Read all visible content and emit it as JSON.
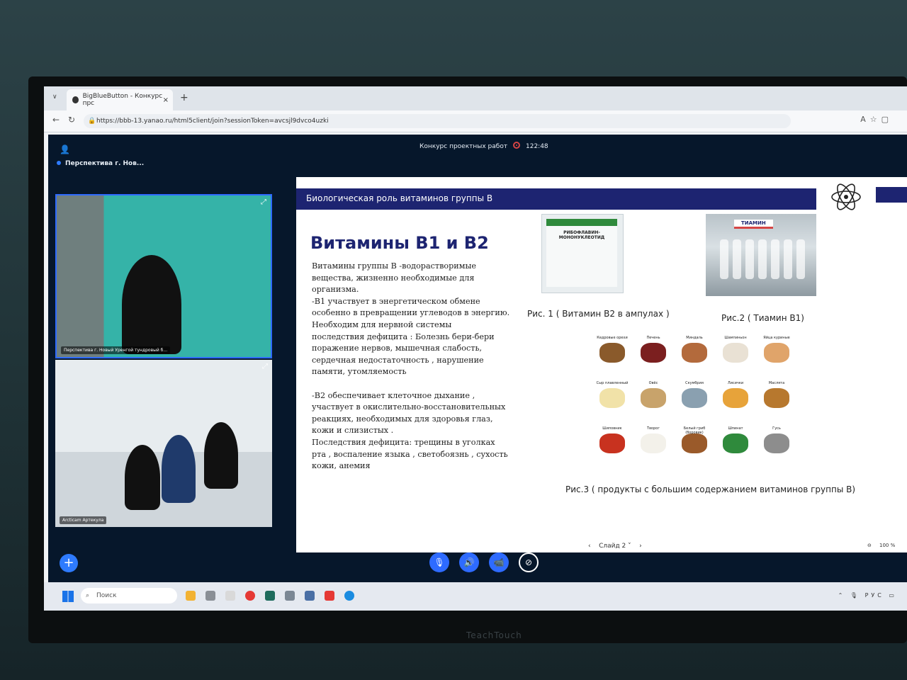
{
  "browser": {
    "tab_title": "BigBlueButton - Конкурс прс",
    "tab_close": "×",
    "new_tab": "+",
    "url": "https://bbb-13.yanao.ru/html5client/join?sessionToken=avcsjl9dvco4uzki"
  },
  "app": {
    "room_name": "Перспектива г. Нов...",
    "meeting_title": "Конкурс проектных работ",
    "recording_time": "122:48",
    "videos": [
      {
        "label": "Перспектива г. Новый Уренгой тундровый б..."
      },
      {
        "label": "Arctiсam Артекула"
      }
    ]
  },
  "slide": {
    "header": "Биологическая роль  витаминов группы В",
    "title": "Витамины В1 и В2",
    "body": "Витамины группы В -водорастворимые вещества, жизненно необходимые для организма.\n-В1 участвует  в энергетическом обмене особенно в превращении углеводов в энергию. Необходим для нервной системы\nпоследствия  дефицита : Болезнь бери-бери поражение нервов,  мышечная слабость, сердечная недостаточность , нарушение памяти, утомляемость\n\n-В2  обеспечивает клеточное дыхание , участвует в окислительно-восстановительных реакциях,  необходимых для здоровья глаз, кожи и слизистых .\nПоследствия дефицита: трещины в уголках рта , воспаление языка , светобоязнь , сухость кожи, анемия",
    "pic1_box": "РИБОФЛАВИН-МОНОНУКЛЕОТИД",
    "pic2_box": "ТИАМИН",
    "caption1": "Рис. 1 ( Витамин В2 в ампулах )",
    "caption2": "Рис.2 ( Тиамин  В1)",
    "caption3": "Рис.3 ( продукты с большим содержанием витаминов группы В)",
    "foods": [
      {
        "name": "Кедровые орехи",
        "color": "#8a5a2b"
      },
      {
        "name": "Печень",
        "color": "#7b1f1f"
      },
      {
        "name": "Миндаль",
        "color": "#b36a3c"
      },
      {
        "name": "Шампиньон",
        "color": "#e9e1d4"
      },
      {
        "name": "Яйца куриные",
        "color": "#e0a46a"
      },
      {
        "name": "Сыр плавленный",
        "color": "#f1e2a8"
      },
      {
        "name": "Овёс",
        "color": "#c8a36b"
      },
      {
        "name": "Скумбрия",
        "color": "#8aa0b0"
      },
      {
        "name": "Лисички",
        "color": "#e7a33a"
      },
      {
        "name": "Маслята",
        "color": "#b7782e"
      },
      {
        "name": "Шиповник",
        "color": "#c8321f"
      },
      {
        "name": "Творог",
        "color": "#f3f1ea"
      },
      {
        "name": "Белый гриб (боровик)",
        "color": "#9a5a2a"
      },
      {
        "name": "Шпинат",
        "color": "#2f8a3c"
      },
      {
        "name": "Гусь",
        "color": "#8d8d8d"
      }
    ],
    "pager": "Слайд 2",
    "zoom": "100 %"
  },
  "taskbar": {
    "search_placeholder": "Поиск",
    "lang": "РУС"
  },
  "monitor_brand": "TeachTouch"
}
